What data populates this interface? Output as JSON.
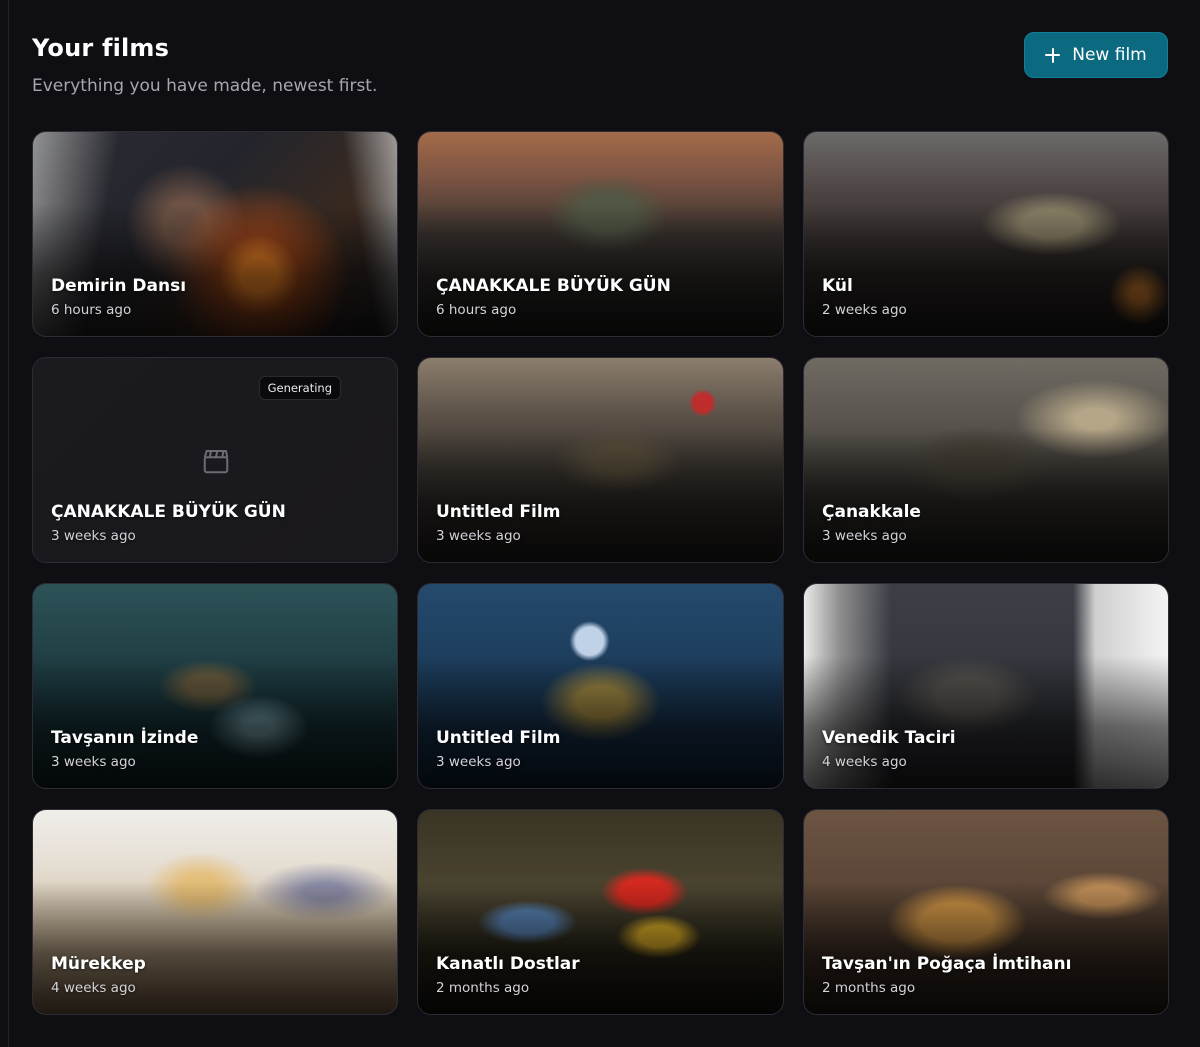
{
  "header": {
    "title": "Your films",
    "subtitle": "Everything you have made, newest first.",
    "new_film_label": "New film"
  },
  "colors": {
    "background": "#0f0e12",
    "accent": "#0b6a80",
    "card_border": "#2e2c33"
  },
  "films": [
    {
      "title": "Demirin Dansı",
      "time": "6 hours ago",
      "art": "forge"
    },
    {
      "title": "ÇANAKKALE BÜYÜK GÜN",
      "time": "6 hours ago",
      "art": "soldier1"
    },
    {
      "title": "Kül",
      "time": "2 weeks ago",
      "art": "kul"
    },
    {
      "title": "ÇANAKKALE BÜYÜK GÜN",
      "time": "3 weeks ago",
      "art": "generating",
      "status": "Generating",
      "icon": "clapperboard-icon"
    },
    {
      "title": "Untitled Film",
      "time": "3 weeks ago",
      "art": "soldier2"
    },
    {
      "title": "Çanakkale",
      "time": "3 weeks ago",
      "art": "canakkale"
    },
    {
      "title": "Tavşanın İzinde",
      "time": "3 weeks ago",
      "art": "forest1"
    },
    {
      "title": "Untitled Film",
      "time": "3 weeks ago",
      "art": "forest2"
    },
    {
      "title": "Venedik Taciri",
      "time": "4 weeks ago",
      "art": "venedik"
    },
    {
      "title": "Mürekkep",
      "time": "4 weeks ago",
      "art": "murekkep"
    },
    {
      "title": "Kanatlı Dostlar",
      "time": "2 months ago",
      "art": "parrot"
    },
    {
      "title": "Tavşan'ın Poğaça İmtihanı",
      "time": "2 months ago",
      "art": "bunny"
    }
  ]
}
